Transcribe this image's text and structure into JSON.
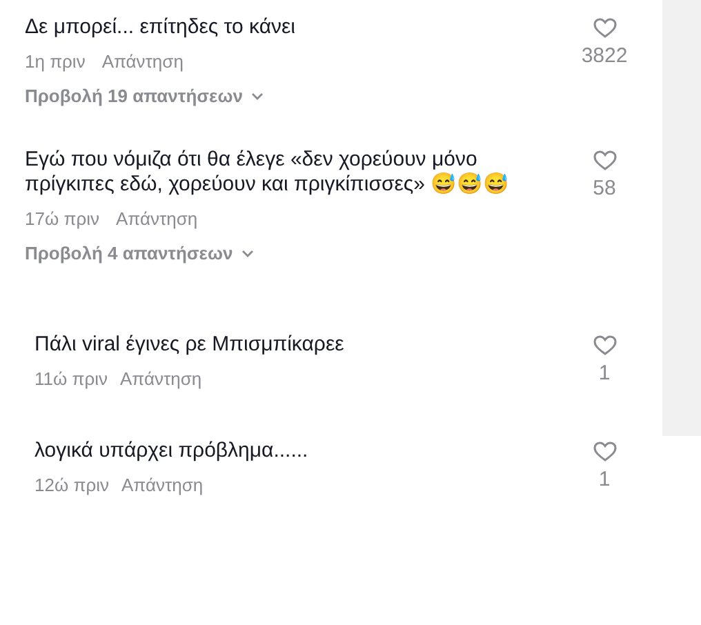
{
  "comments": [
    {
      "kind": "comment",
      "text": "Δε μπορεί... επίτηδες το κάνει",
      "time": "1η πριν",
      "reply": "Απάντηση",
      "likes": "3822",
      "view_replies": "Προβολή 19 απαντήσεων"
    },
    {
      "kind": "comment",
      "text": "Εγώ που νόμιζα ότι θα έλεγε «δεν χορεύουν μόνο πρίγκιπες εδώ, χορεύουν και πριγκίπισσες» 😅😅😅",
      "time": "17ώ πριν",
      "reply": "Απάντηση",
      "likes": "58",
      "view_replies": "Προβολή 4 απαντήσεων"
    },
    {
      "kind": "reply",
      "text": "Πάλι viral έγινες ρε Μπισμπίκαρεε",
      "time": "11ώ πριν",
      "reply": "Απάντηση",
      "likes": "1"
    },
    {
      "kind": "reply",
      "text": "λογικά υπάρχει πρόβλημα......",
      "time": "12ώ πριν",
      "reply": "Απάντηση",
      "likes": "1"
    }
  ]
}
